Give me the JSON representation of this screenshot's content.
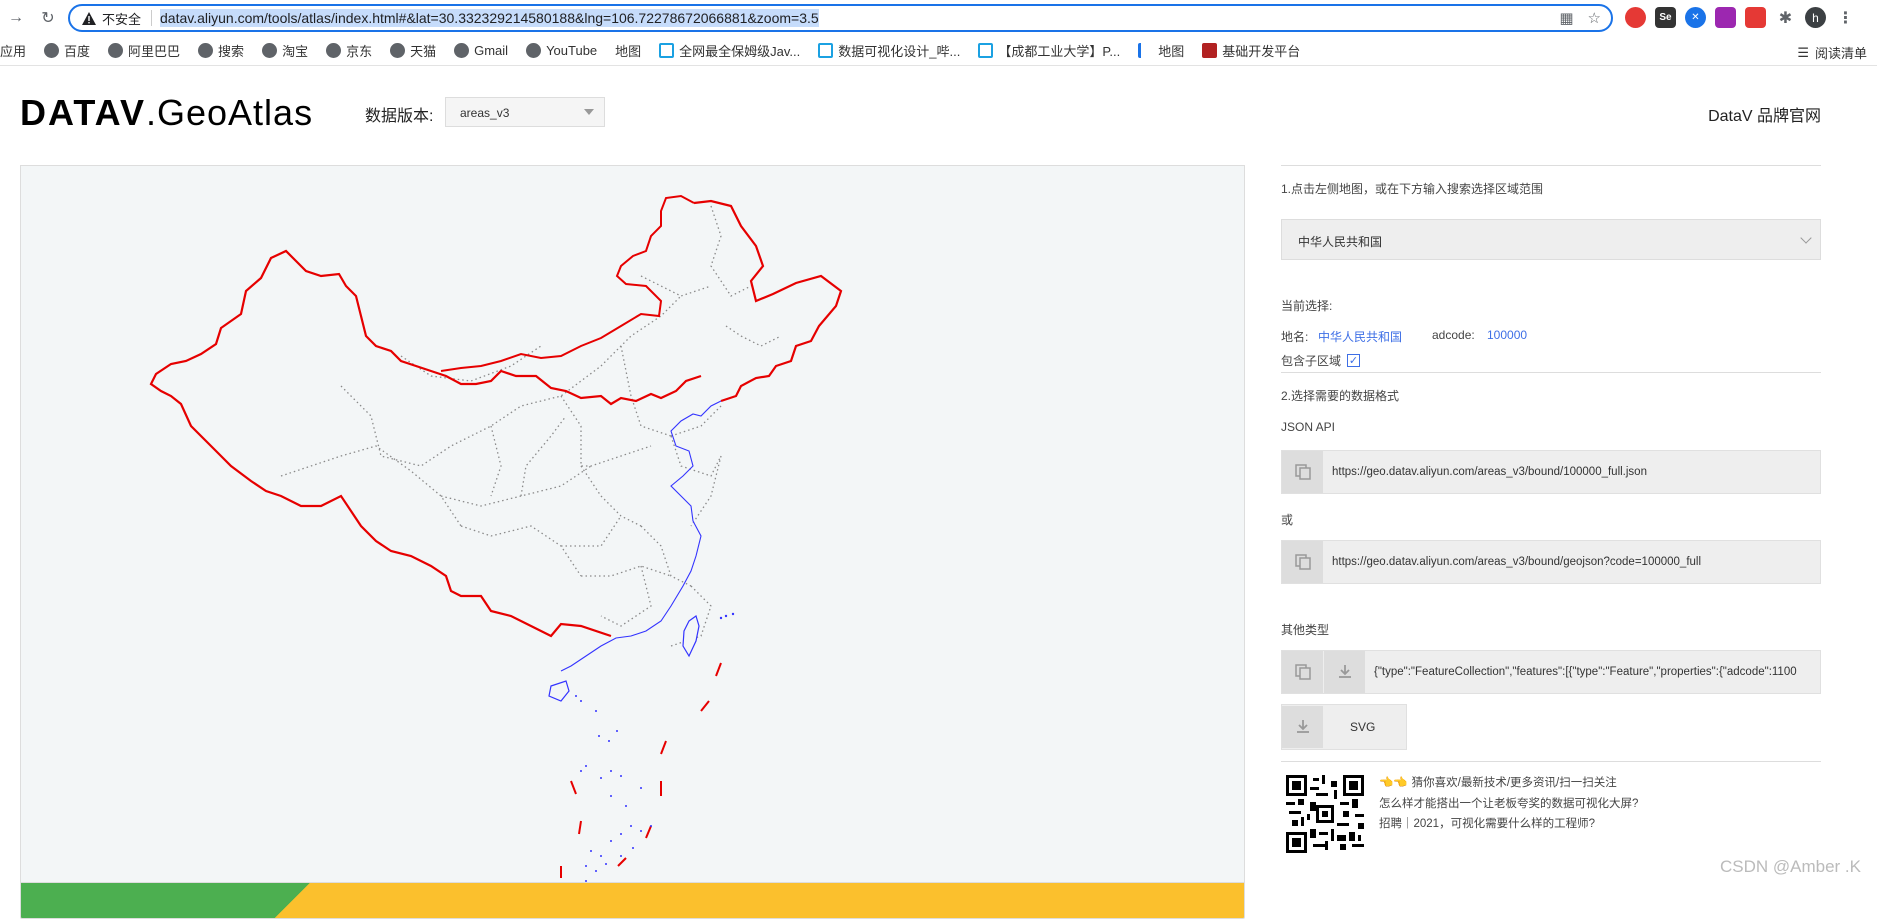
{
  "browser": {
    "security_label": "不安全",
    "url": "datav.aliyun.com/tools/atlas/index.html#&lat=30.332329214580188&lng=106.72278672066881&zoom=3.5",
    "bookmarks": [
      "应用",
      "百度",
      "阿里巴巴",
      "搜索",
      "淘宝",
      "京东",
      "天猫",
      "Gmail",
      "YouTube",
      "地图",
      "全网最全保姆级Jav...",
      "数据可视化设计_哔...",
      "【成都工业大学】P...",
      "地图",
      "基础开发平台"
    ],
    "reading_list": "阅读清单",
    "profile_initial": "h"
  },
  "header": {
    "logo_bold": "DATAV",
    "logo_light": ".GeoAtlas",
    "version_label": "数据版本:",
    "version_value": "areas_v3",
    "brand_link": "DataV 品牌官网"
  },
  "panel": {
    "step1": "1.点击左侧地图，或在下方输入搜索选择区域范围",
    "region": "中华人民共和国",
    "current_label": "当前选择:",
    "name_label": "地名:",
    "name_value": "中华人民共和国",
    "adcode_label": "adcode:",
    "adcode_value": "100000",
    "include_sub": "包含子区域",
    "include_sub_checked": true,
    "step2": "2.选择需要的数据格式",
    "json_api_label": "JSON API",
    "api_url_1": "https://geo.datav.aliyun.com/areas_v3/bound/100000_full.json",
    "or_label": "或",
    "api_url_2": "https://geo.datav.aliyun.com/areas_v3/bound/geojson?code=100000_full",
    "other_label": "其他类型",
    "geojson_preview": "{\"type\":\"FeatureCollection\",\"features\":[{\"type\":\"Feature\",\"properties\":{\"adcode\":1100",
    "svg_label": "SVG"
  },
  "promo": {
    "line1": "猜你喜欢/最新技术/更多资讯/扫一扫关注",
    "line2": "怎么样才能搭出一个让老板夸奖的数据可视化大屏?",
    "line3": "招聘｜2021，可视化需要什么样的工程师?"
  },
  "watermark": "CSDN @Amber .K",
  "colors": {
    "accent": "#3e6fe6",
    "border_red": "#e60000",
    "coast_blue": "#3333ff"
  }
}
